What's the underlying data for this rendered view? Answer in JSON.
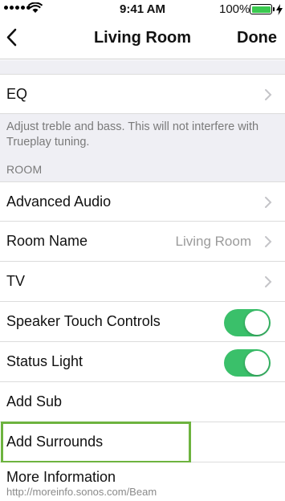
{
  "status_bar": {
    "time": "9:41 AM",
    "battery_percent": "100%",
    "battery_level": 1.0,
    "battery_color": "#3ac94f",
    "icons": [
      "signal-dots",
      "wifi-icon",
      "battery-icon",
      "charging-icon"
    ]
  },
  "nav": {
    "title": "Living Room",
    "back_icon": "chevron-left-icon",
    "done_label": "Done"
  },
  "eq": {
    "label": "EQ",
    "description": "Adjust treble and bass. This will not interfere with Trueplay tuning."
  },
  "room": {
    "section_label": "ROOM",
    "advanced_audio": "Advanced Audio",
    "room_name_label": "Room Name",
    "room_name_value": "Living Room",
    "tv": "TV",
    "speaker_touch_controls": "Speaker Touch Controls",
    "speaker_touch_controls_on": true,
    "status_light": "Status Light",
    "status_light_on": true,
    "add_sub": "Add Sub",
    "add_surrounds": "Add Surrounds",
    "more_info": "More Information",
    "more_info_url": "http://moreinfo.sonos.com/Beam"
  },
  "colors": {
    "toggle_on": "#3ac06a",
    "highlight": "#6db33f",
    "grouped_background": "#efeff4"
  }
}
